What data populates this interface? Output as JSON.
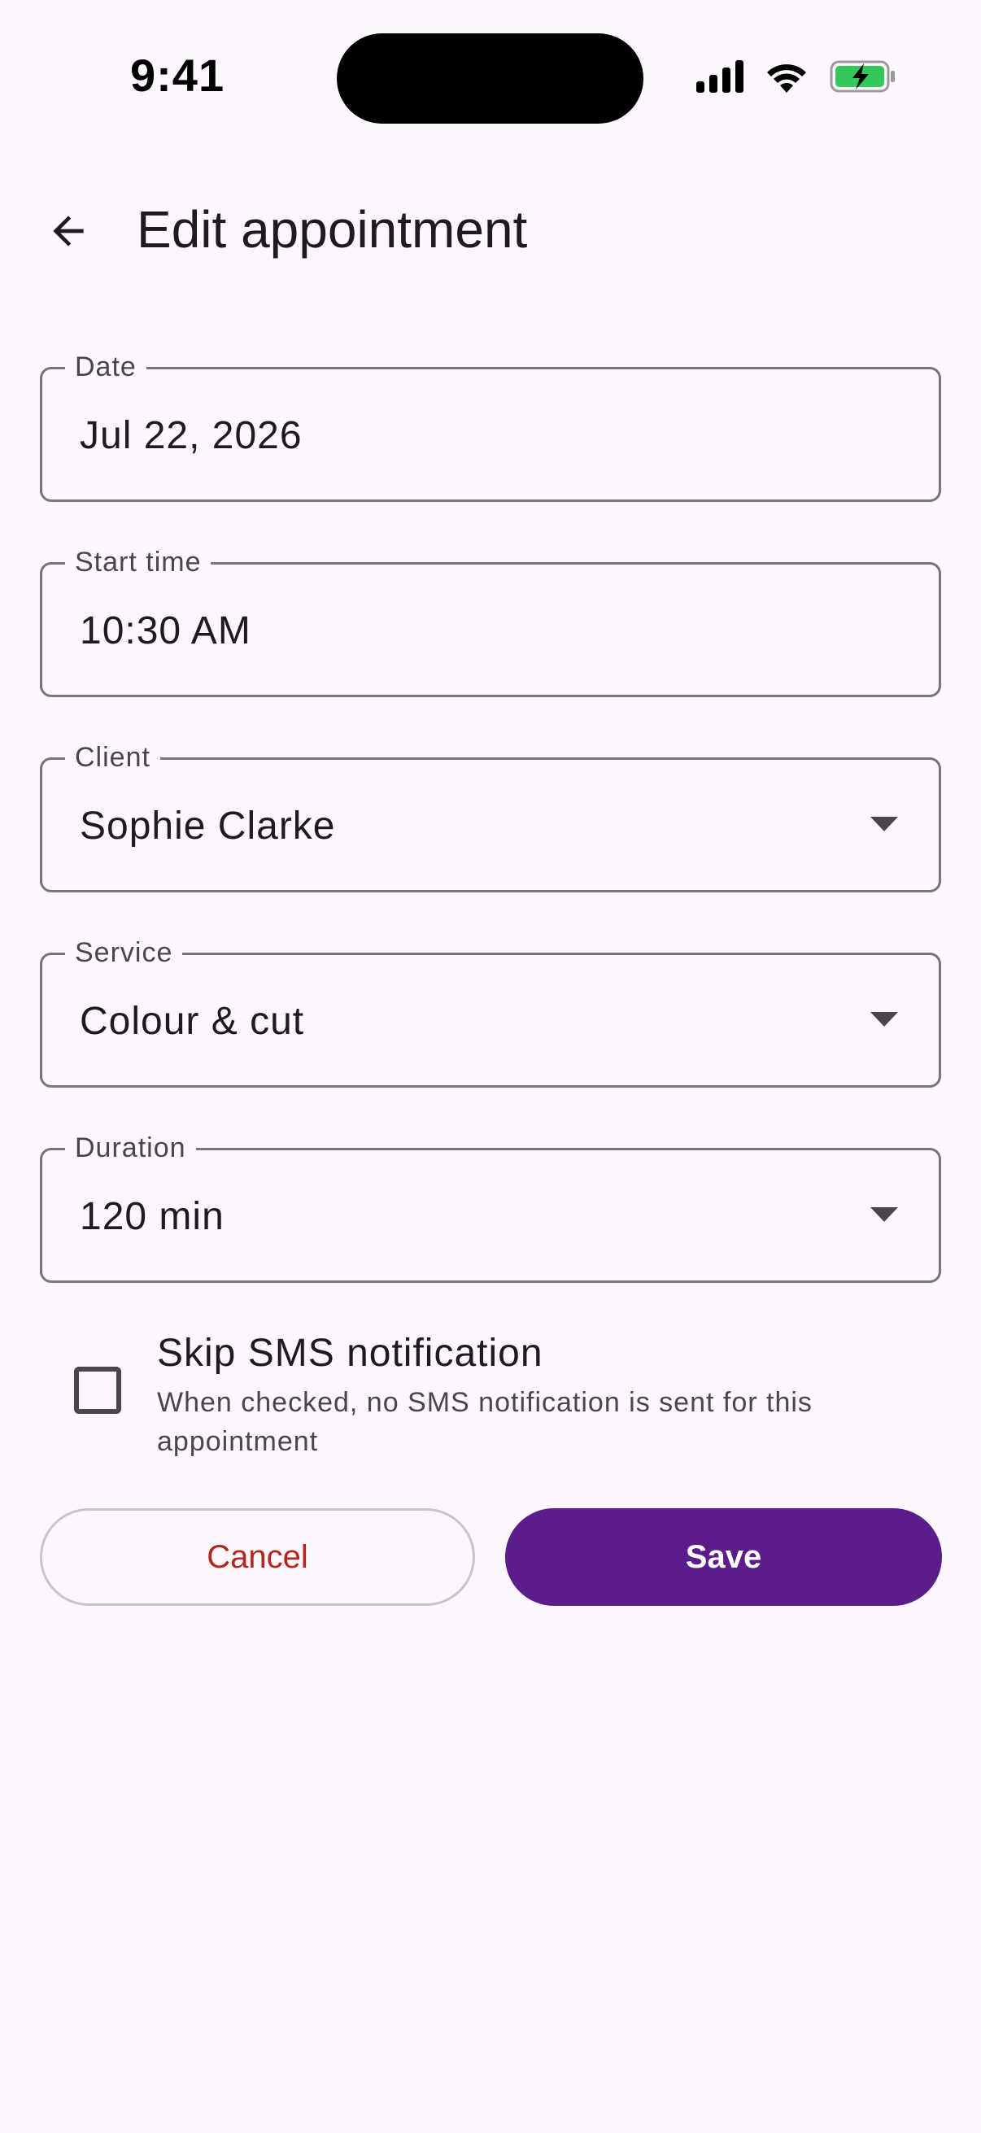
{
  "status_bar": {
    "time": "9:41",
    "icons": [
      "cellular-signal-icon",
      "wifi-icon",
      "battery-charging-icon"
    ],
    "battery_color": "#34c759"
  },
  "app_bar": {
    "back_icon": "arrow-back-icon",
    "title": "Edit appointment"
  },
  "form": {
    "date": {
      "label": "Date",
      "value": "Jul 22, 2026"
    },
    "start_time": {
      "label": "Start time",
      "value": "10:30 AM"
    },
    "client": {
      "label": "Client",
      "value": "Sophie Clarke",
      "icon": "dropdown-arrow-icon"
    },
    "service": {
      "label": "Service",
      "value": "Colour & cut",
      "icon": "dropdown-arrow-icon"
    },
    "duration": {
      "label": "Duration",
      "value": "120 min",
      "icon": "dropdown-arrow-icon"
    }
  },
  "skip_sms": {
    "checked": false,
    "title": "Skip SMS notification",
    "subtitle": "When checked, no SMS notification is sent for this appointment"
  },
  "actions": {
    "cancel_label": "Cancel",
    "save_label": "Save"
  },
  "colors": {
    "background": "#fcf7fc",
    "primary": "#5b1c8c",
    "cancel_text": "#b3261e",
    "outline": "#79747e"
  }
}
